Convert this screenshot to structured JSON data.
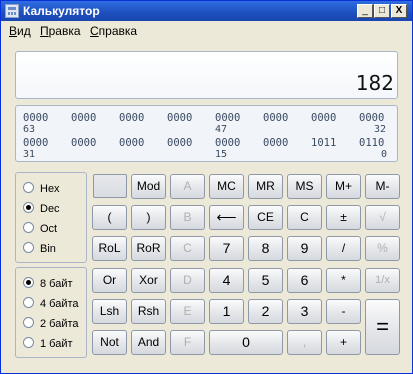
{
  "window": {
    "title": "Калькулятор",
    "minimize": "_",
    "maximize": "□",
    "close": "X"
  },
  "menu": [
    {
      "label": "Вид",
      "underline": "В",
      "rest": "ид"
    },
    {
      "label": "Правка",
      "underline": "П",
      "rest": "равка"
    },
    {
      "label": "Справка",
      "underline": "С",
      "rest": "правка"
    }
  ],
  "display": {
    "value": "182"
  },
  "binary": {
    "row1_groups": [
      "0000",
      "0000",
      "0000",
      "0000",
      "0000",
      "0000",
      "0000",
      "0000"
    ],
    "row1_positions": [
      "63",
      "47",
      "32"
    ],
    "row2_groups": [
      "0000",
      "0000",
      "0000",
      "0000",
      "0000",
      "0000",
      "1011",
      "0110"
    ],
    "row2_positions": [
      "31",
      "15",
      "0"
    ]
  },
  "base_options": [
    {
      "label": "Hex",
      "selected": false
    },
    {
      "label": "Dec",
      "selected": true
    },
    {
      "label": "Oct",
      "selected": false
    },
    {
      "label": "Bin",
      "selected": false
    }
  ],
  "word_options": [
    {
      "label": "8 байт",
      "selected": true
    },
    {
      "label": "4 байта",
      "selected": false
    },
    {
      "label": "2 байта",
      "selected": false
    },
    {
      "label": "1 байт",
      "selected": false
    }
  ],
  "buttons": {
    "r1": [
      "Mod",
      "A",
      "MC",
      "MR",
      "MS",
      "M+",
      "M-"
    ],
    "r2": [
      "(",
      ")",
      "B",
      "⟵",
      "CE",
      "C",
      "±",
      "√"
    ],
    "r3": [
      "RoL",
      "RoR",
      "C",
      "7",
      "8",
      "9",
      "/",
      "%"
    ],
    "r4": [
      "Or",
      "Xor",
      "D",
      "4",
      "5",
      "6",
      "*",
      "1/x"
    ],
    "r5": [
      "Lsh",
      "Rsh",
      "E",
      "1",
      "2",
      "3",
      "-"
    ],
    "r6": [
      "Not",
      "And",
      "F",
      "0",
      ",",
      "+"
    ],
    "equals": "="
  }
}
